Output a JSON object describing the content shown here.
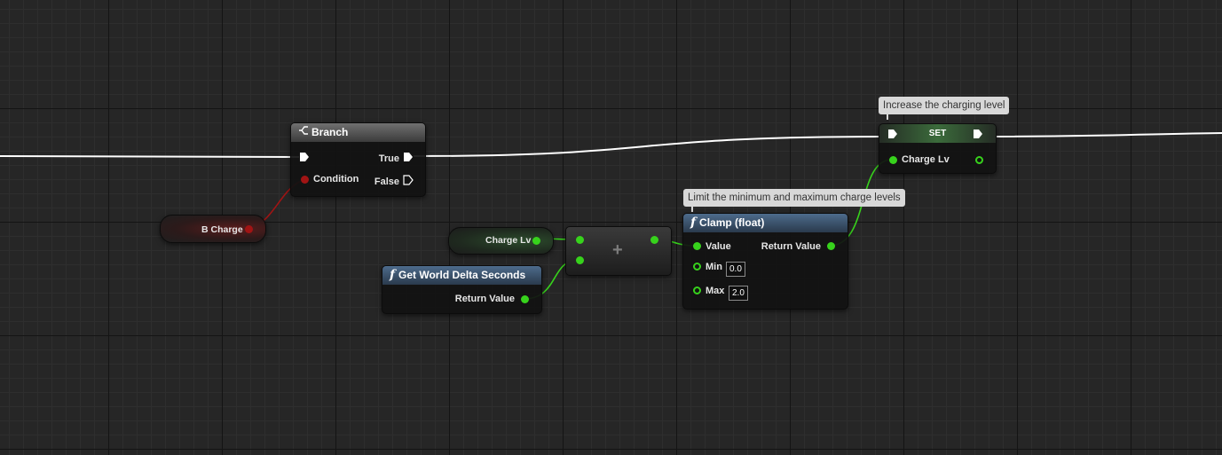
{
  "colors": {
    "exec_wire": "#ffffff",
    "float_wire": "#37d21c",
    "bool_wire": "#a11414",
    "func_header": "#4d6b8c"
  },
  "branch_node": {
    "icon": "branch-icon",
    "title": "Branch",
    "condition_label": "Condition",
    "true_label": "True",
    "false_label": "False"
  },
  "b_charge_var": {
    "label": "B Charge"
  },
  "charge_lv_getter": {
    "label": "Charge Lv"
  },
  "get_world_delta": {
    "icon": "function-icon",
    "title": "Get World Delta Seconds",
    "return_label": "Return Value"
  },
  "add_node": {
    "symbol": "+"
  },
  "clamp_node": {
    "icon": "function-icon",
    "comment": "Limit the minimum and maximum charge levels",
    "title": "Clamp (float)",
    "value_label": "Value",
    "return_label": "Return Value",
    "min_label": "Min",
    "min_value": "0.0",
    "max_label": "Max",
    "max_value": "2.0"
  },
  "set_node": {
    "comment": "Increase the charging level",
    "title": "SET",
    "charge_label": "Charge Lv"
  }
}
